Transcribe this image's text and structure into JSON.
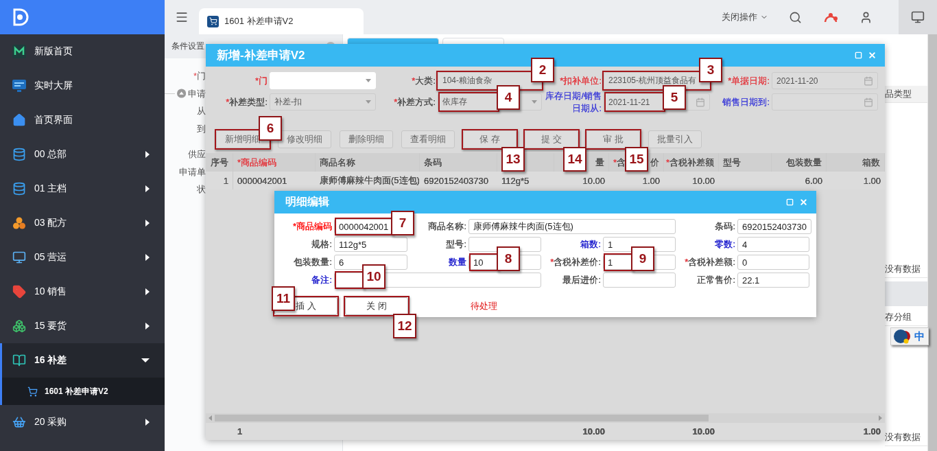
{
  "sidebar": {
    "items": [
      {
        "label": "新版首页",
        "kind": "m-logo",
        "selected": false
      },
      {
        "label": "实时大屏",
        "kind": "screen",
        "selected": false
      },
      {
        "label": "首页界面",
        "kind": "home",
        "selected": false
      },
      {
        "label": "00 总部",
        "kind": "database",
        "expanded": false,
        "selected": false
      },
      {
        "label": "01 主档",
        "kind": "database",
        "expanded": false,
        "selected": false
      },
      {
        "label": "03 配方",
        "kind": "cluster",
        "expanded": false,
        "selected": false
      },
      {
        "label": "05 营运",
        "kind": "monitor",
        "expanded": false,
        "selected": false
      },
      {
        "label": "10 销售",
        "kind": "tag",
        "expanded": false,
        "selected": false
      },
      {
        "label": "15 要货",
        "kind": "boxes",
        "expanded": false,
        "selected": false
      },
      {
        "label": "16 补差",
        "kind": "book",
        "expanded": true,
        "selected": true,
        "children": [
          {
            "label": "1601 补差申请V2",
            "selected": true
          }
        ]
      },
      {
        "label": "20 采购",
        "kind": "basket",
        "expanded": false,
        "selected": false
      }
    ]
  },
  "topbar": {
    "tab": {
      "title": "1601 补差申请V2",
      "selected": true
    },
    "close_menu": "关闭操作"
  },
  "background": {
    "panel_title": "条件设置",
    "groups": [
      {
        "labels": [
          {
            "star": "*",
            "text": "门",
            "kind": "label"
          },
          {
            "text": "申请",
            "kind": "section"
          },
          {
            "text": "从",
            "kind": "label"
          },
          {
            "text": "到",
            "kind": "label"
          }
        ]
      },
      {
        "labels": [
          {
            "text": "供应",
            "kind": "label"
          },
          {
            "text": "申请单",
            "kind": "label"
          },
          {
            "text": "状",
            "kind": "label"
          }
        ]
      }
    ],
    "right_texts": [
      {
        "text": "品类型",
        "kind": "header"
      },
      {
        "text": "没有数据",
        "kind": "row"
      },
      {
        "text": "存分组",
        "kind": "row"
      },
      {
        "text": "没有数据",
        "kind": "row"
      }
    ]
  },
  "dialog": {
    "title": "新增-补差申请V2",
    "fields": [
      {
        "star": "*",
        "label": {
          "text": "门",
          "color": "#e2454b"
        },
        "kind": "select",
        "redacted": true
      },
      {
        "star": "*",
        "label": {
          "text": "大类:",
          "color": "#555555"
        },
        "kind": "select",
        "value": "104-粮油食杂",
        "callout": {
          "label": "2",
          "kind": "above"
        }
      },
      {
        "star": "*",
        "label": {
          "text": "扣补单位:",
          "color": "#e2454b"
        },
        "kind": "text",
        "value": "223105-杭州顶益食品有",
        "callout": {
          "label": "3",
          "kind": "above"
        }
      },
      {
        "star": "*",
        "label": {
          "text": "单据日期:",
          "color": "#e2454b"
        },
        "kind": "date",
        "value": "2021-11-20"
      },
      {
        "star": "*",
        "label": {
          "text": "补差类型:",
          "color": "#555555"
        },
        "kind": "select",
        "value": "补差-扣"
      },
      {
        "star": "*",
        "label": {
          "text": "补差方式:",
          "color": "#555555"
        },
        "kind": "select",
        "value": "依库存",
        "callout": {
          "label": "4",
          "kind": "beside"
        }
      },
      {
        "label": {
          "text": "库存日期/销售日期从:",
          "color": "#4a4ad8"
        },
        "kind": "date",
        "value": "2021-11-21",
        "callout": {
          "label": "5",
          "kind": "beside"
        }
      },
      {
        "label": {
          "text": "销售日期到:",
          "color": "#4a4ad8"
        },
        "kind": "date"
      }
    ],
    "buttons": [
      {
        "label": "新增明细",
        "callout": {
          "label": "6",
          "kind": "above"
        }
      },
      {
        "label": "修改明细"
      },
      {
        "label": "删除明细"
      },
      {
        "label": "查看明细"
      },
      {
        "label": "保 存",
        "callout": {
          "label": "13",
          "kind": "below"
        }
      },
      {
        "label": "提 交",
        "callout": {
          "label": "14",
          "kind": "below"
        }
      },
      {
        "label": "审 批",
        "callout": {
          "label": "15",
          "kind": "below"
        }
      },
      {
        "label": "批量引入"
      }
    ],
    "table": {
      "columns": [
        {
          "label": "序号",
          "kind": "number",
          "color": "#555555"
        },
        {
          "label": "*商品编码",
          "kind": "text",
          "color": "#e2454b",
          "total": "1"
        },
        {
          "label": "商品名称",
          "kind": "text",
          "color": "#555555"
        },
        {
          "label": "条码",
          "kind": "text",
          "color": "#555555"
        },
        {
          "kind": "text"
        },
        {
          "label": "量",
          "kind": "number",
          "color": "#555555",
          "total": "10.00"
        },
        {
          "star": "*",
          "label": "含",
          "tail": "价",
          "kind": "number",
          "color": "#555555"
        },
        {
          "star": "*",
          "label": "含税补差额",
          "kind": "number",
          "color": "#555555",
          "total": "10.00"
        },
        {
          "label": "型号",
          "kind": "text",
          "color": "#555555"
        },
        {
          "label": "包装数量",
          "kind": "number",
          "color": "#555555"
        },
        {
          "label": "箱数",
          "kind": "number",
          "color": "#555555",
          "total": "1.00"
        }
      ],
      "rows": [
        {
          "cells": [
            {
              "text": "1"
            },
            {
              "text": "0000042001"
            },
            {
              "text": "康师傅麻辣牛肉面(5连包)"
            },
            {
              "text": "6920152403730"
            },
            {
              "text": "112g*5"
            },
            {
              "text": "10.00"
            },
            {
              "text": "1.00"
            },
            {
              "text": "10.00"
            },
            {},
            {
              "text": "6.00"
            },
            {
              "text": "1.00"
            }
          ]
        }
      ]
    }
  },
  "detail_dialog": {
    "title": "明细编辑",
    "fields": [
      {
        "label": {
          "text": "*商品编码",
          "color": "#ff2020"
        },
        "value": "0000042001",
        "wide": false,
        "callout": {
          "label": "7",
          "kind": "beside"
        }
      },
      {
        "label": {
          "text": "商品名称:",
          "color": "#555555"
        },
        "value": "康师傅麻辣牛肉面(5连包)",
        "wide": true
      },
      {
        "label": {
          "text": "条码:",
          "color": "#555555"
        },
        "value": "6920152403730",
        "wide": false
      },
      {
        "label": {
          "text": "规格:",
          "color": "#555555"
        },
        "value": "112g*5",
        "wide": false
      },
      {
        "label": {
          "text": "型号:",
          "color": "#555555"
        },
        "wide": false
      },
      {
        "label": {
          "text": "箱数:",
          "color": "#2a2ad0"
        },
        "value": "1",
        "wide": false
      },
      {
        "label": {
          "text": "零数:",
          "color": "#2a2ad0"
        },
        "value": "4",
        "wide": false
      },
      {
        "label": {
          "text": "包装数量:",
          "color": "#555555"
        },
        "value": "6",
        "wide": false
      },
      {
        "label": {
          "text": "数量",
          "color": "#2a2ad0"
        },
        "value": "10",
        "wide": false,
        "callout": {
          "label": "8",
          "kind": "beside"
        }
      },
      {
        "star": "*",
        "label": {
          "text": "含税补差价:",
          "color": "#555555"
        },
        "value": "1",
        "wide": false,
        "callout": {
          "label": "9",
          "kind": "beside"
        }
      },
      {
        "star": "*",
        "label": {
          "text": "含税补差额:",
          "color": "#555555"
        },
        "value": "0",
        "wide": false
      },
      {
        "label": {
          "text": "备注:",
          "color": "#2a2ad0"
        },
        "wide": true,
        "callout": {
          "label": "10",
          "kind": "beside"
        }
      },
      {
        "label": {
          "text": "最后进价:",
          "color": "#555555"
        },
        "wide": false
      },
      {
        "label": {
          "text": "正常售价:",
          "color": "#555555"
        },
        "value": "22.1",
        "wide": false
      }
    ],
    "buttons": [
      {
        "label": "插 入",
        "callout": {
          "label": "11",
          "kind": "left"
        }
      },
      {
        "label": "关 闭",
        "callout": {
          "label": "12",
          "kind": "below"
        }
      }
    ],
    "status": "待处理"
  },
  "ime": {
    "label": "中"
  }
}
